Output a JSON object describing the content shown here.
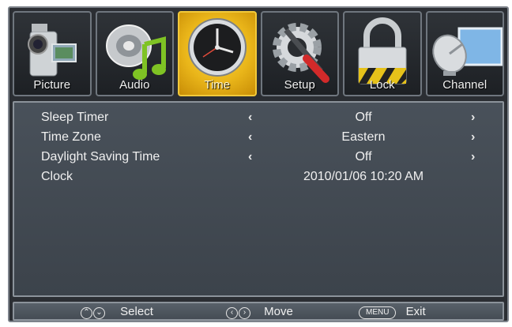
{
  "tabs": [
    {
      "label": "Picture",
      "icon": "camcorder-icon",
      "active": false
    },
    {
      "label": "Audio",
      "icon": "speaker-music-note-icon",
      "active": false
    },
    {
      "label": "Time",
      "icon": "clock-icon",
      "active": true
    },
    {
      "label": "Setup",
      "icon": "gear-tools-icon",
      "active": false
    },
    {
      "label": "Lock",
      "icon": "padlock-icon",
      "active": false
    },
    {
      "label": "Channel",
      "icon": "satellite-dish-icon",
      "active": false
    }
  ],
  "settings": [
    {
      "label": "Sleep Timer",
      "value": "Off",
      "left": "‹",
      "right": "›"
    },
    {
      "label": "Time Zone",
      "value": "Eastern",
      "left": "‹",
      "right": "›"
    },
    {
      "label": "Daylight Saving Time",
      "value": "Off",
      "left": "‹",
      "right": "›"
    },
    {
      "label": "Clock",
      "value": "2010/01/06 10:20 AM"
    }
  ],
  "hints": {
    "select_up": "⌃",
    "select_down": "⌄",
    "select_label": "Select",
    "move_left": "‹",
    "move_right": "›",
    "move_label": "Move",
    "menu_key": "MENU",
    "exit_label": "Exit"
  },
  "colors": {
    "active_tab": "#eab61a",
    "panel": "#444b53",
    "frame": "#2b2e33"
  }
}
